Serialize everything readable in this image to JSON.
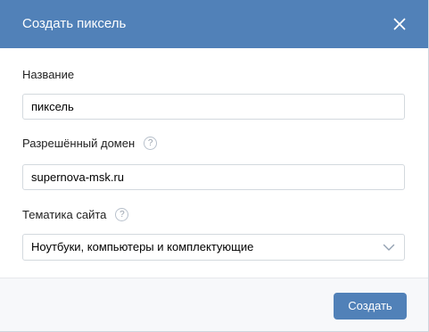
{
  "dialog": {
    "title": "Создать пиксель",
    "close_icon": "close-icon",
    "header_color": "#5181b8"
  },
  "form": {
    "name": {
      "label": "Название",
      "value": "пиксель"
    },
    "domain": {
      "label": "Разрешённый домен",
      "help_icon": "question-icon",
      "help_glyph": "?",
      "value": "supernova-msk.ru"
    },
    "topic": {
      "label": "Тематика сайта",
      "help_icon": "question-icon",
      "help_glyph": "?",
      "selected": "Ноутбуки, компьютеры и комплектующие",
      "chevron_icon": "chevron-down-icon"
    }
  },
  "footer": {
    "submit_label": "Создать",
    "button_color": "#5181b8"
  }
}
